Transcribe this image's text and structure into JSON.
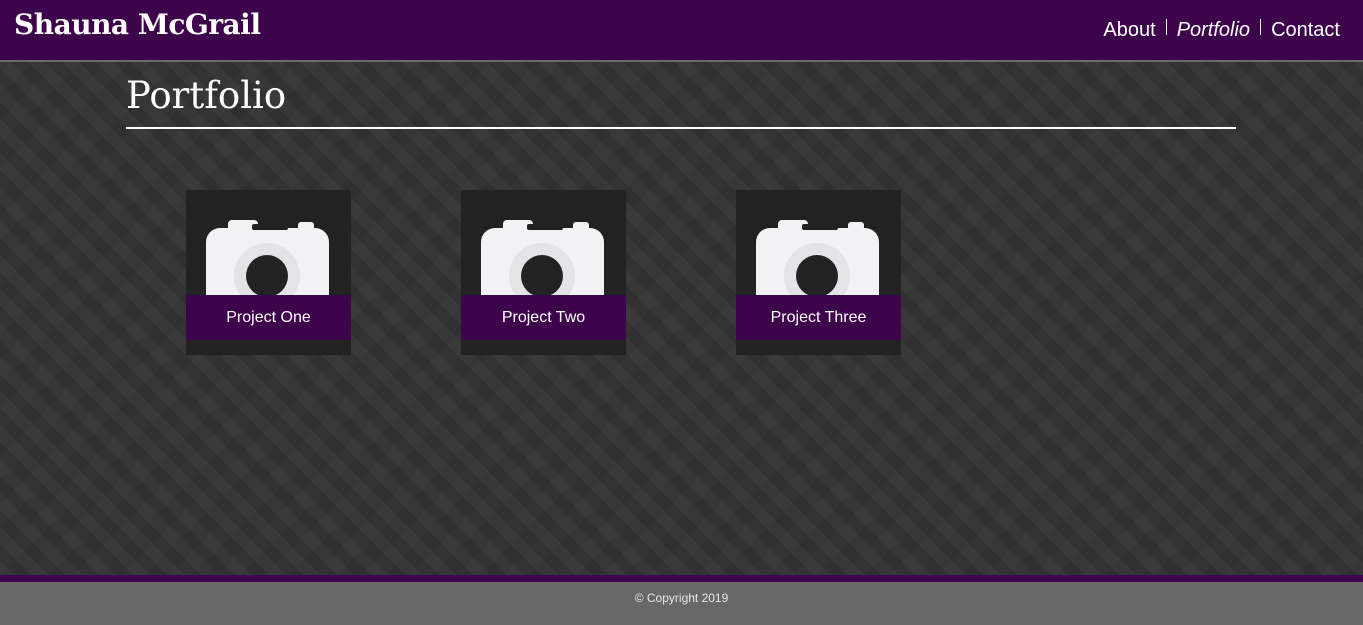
{
  "header": {
    "site_name": "Shauna McGrail",
    "nav": [
      {
        "label": "About",
        "active": false
      },
      {
        "label": "Portfolio",
        "active": true
      },
      {
        "label": "Contact",
        "active": false
      }
    ]
  },
  "main": {
    "title": "Portfolio",
    "projects": [
      {
        "label": "Project One",
        "icon": "camera-icon"
      },
      {
        "label": "Project Two",
        "icon": "camera-icon"
      },
      {
        "label": "Project Three",
        "icon": "camera-icon"
      }
    ]
  },
  "footer": {
    "copyright": "© Copyright 2019"
  },
  "colors": {
    "brand_purple": "#3d034b",
    "background": "#333333",
    "footer_gray": "#686868",
    "card_dark": "#222222"
  }
}
